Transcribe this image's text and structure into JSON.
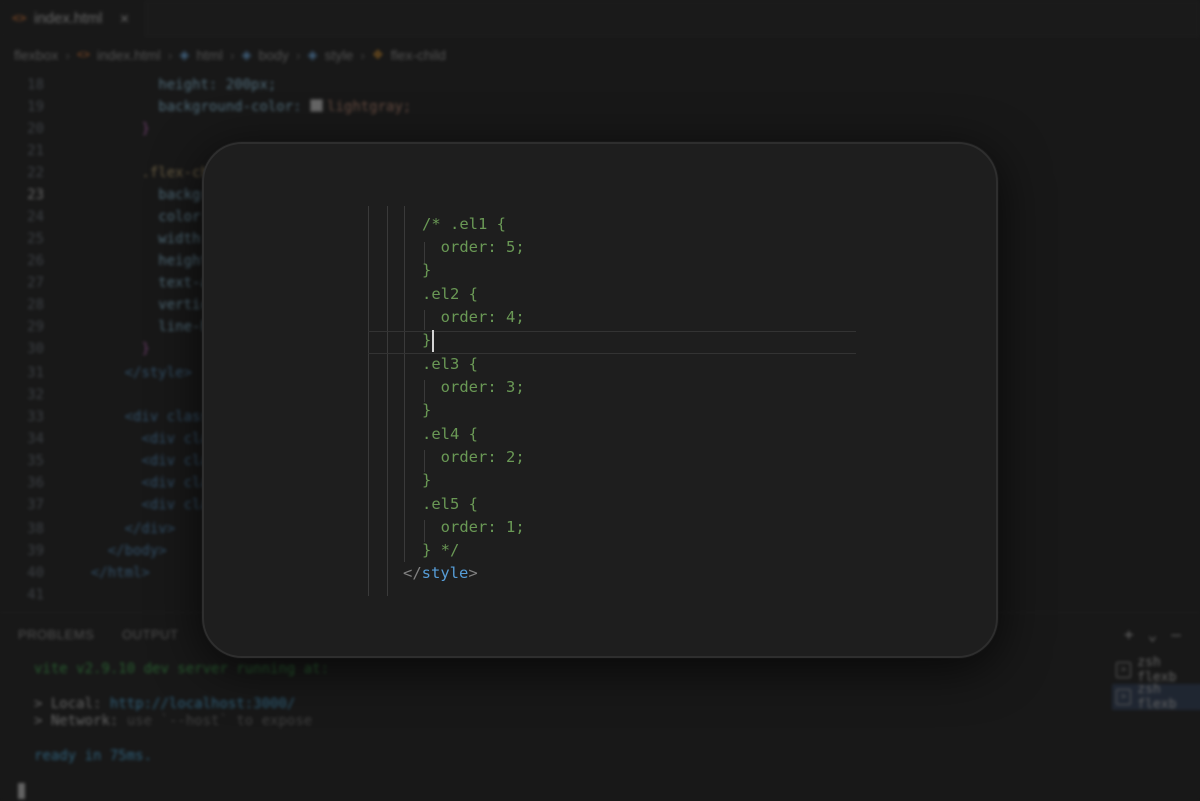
{
  "editor": {
    "tab": {
      "icon_glyph": "<>",
      "label": "index.html",
      "close_glyph": "✕"
    },
    "breadcrumb": {
      "items": [
        {
          "label": "flexbox"
        },
        {
          "label": "index.html"
        },
        {
          "label": "html"
        },
        {
          "label": "body"
        },
        {
          "label": "style"
        },
        {
          "label": "flex-child"
        }
      ]
    },
    "bg_lines": [
      {
        "num": "18",
        "text": "height: 200px;"
      },
      {
        "num": "19",
        "text": "background-color:",
        "value": "lightgray;"
      },
      {
        "num": "20",
        "text": "}"
      },
      {
        "num": "21",
        "text": ""
      },
      {
        "num": "22",
        "text": ".flex-ch"
      },
      {
        "num": "23",
        "text": "backgro"
      },
      {
        "num": "24",
        "text": "color:"
      },
      {
        "num": "25",
        "text": "width:"
      },
      {
        "num": "26",
        "text": "height"
      },
      {
        "num": "27",
        "text": "text-a"
      },
      {
        "num": "28",
        "text": "vertic"
      },
      {
        "num": "29",
        "text": "line-h"
      },
      {
        "num": "30",
        "text": "}"
      },
      {
        "num": "31",
        "text": "</style>"
      },
      {
        "num": "32",
        "text": ""
      },
      {
        "num": "33",
        "text": "<div class"
      },
      {
        "num": "34",
        "text": "<div cla"
      },
      {
        "num": "35",
        "text": "<div cla"
      },
      {
        "num": "36",
        "text": "<div cla"
      },
      {
        "num": "37",
        "text": "<div cla"
      },
      {
        "num": "38",
        "text": "</div>"
      },
      {
        "num": "39",
        "text": "</body>"
      },
      {
        "num": "40",
        "text": "</html>"
      },
      {
        "num": "41",
        "text": ""
      }
    ]
  },
  "panel": {
    "tabs": [
      "PROBLEMS",
      "OUTPUT"
    ],
    "terminal": {
      "line1": {
        "label": "vite v2.9.10",
        "rest": "dev server running at:"
      },
      "line2": {
        "arrow": ">",
        "label": "Local:",
        "url": "http://localhost:3000/"
      },
      "line3": {
        "arrow": ">",
        "label": "Network:",
        "rest": "use `--host` to expose"
      },
      "line4": "ready in 75ms."
    },
    "actions": {
      "add": "+",
      "chevron": "⌄",
      "minimize": "—"
    },
    "terminal_list": [
      {
        "label": "zsh  flexb"
      },
      {
        "label": "zsh  flexb"
      }
    ]
  },
  "card": {
    "code": [
      "/* .el1 {",
      "  order: 5;",
      "}",
      ".el2 {",
      "  order: 4;",
      "}",
      ".el3 {",
      "  order: 3;",
      "}",
      ".el4 {",
      "  order: 2;",
      "}",
      ".el5 {",
      "  order: 1;",
      "} */"
    ],
    "closing_tag": {
      "open": "</",
      "name": "style",
      "close": ">"
    }
  }
}
